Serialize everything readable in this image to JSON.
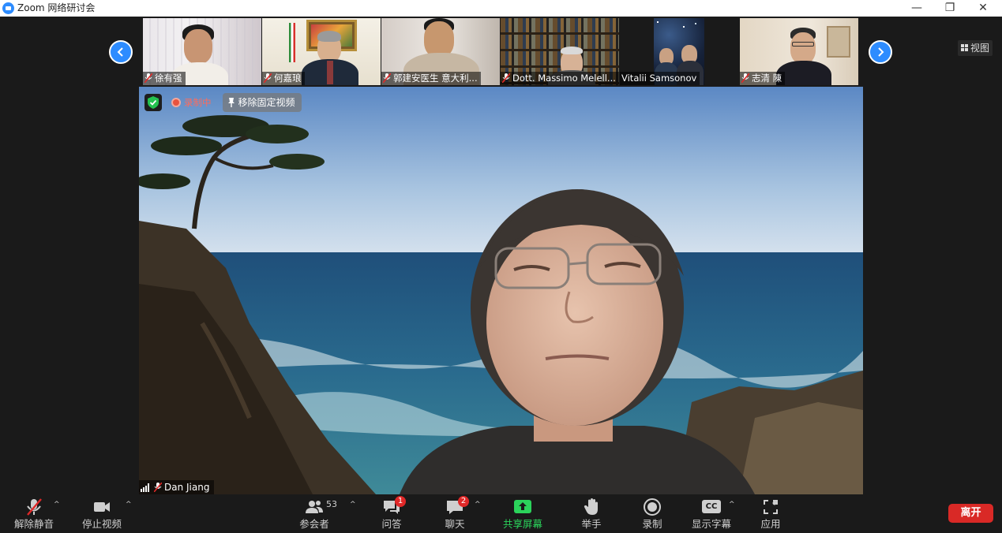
{
  "window": {
    "title": "Zoom 网络研讨会",
    "controls": {
      "minimize": "—",
      "restore": "❐",
      "close": "✕"
    }
  },
  "gallery_strip": {
    "participants": [
      {
        "name": "徐有强",
        "muted": true
      },
      {
        "name": "何嘉琅",
        "muted": true
      },
      {
        "name": "郭建安医生 意大利...",
        "muted": true
      },
      {
        "name": "Dott. Massimo Melell...",
        "muted": true
      },
      {
        "name": "Vitalii Samsonov",
        "muted": false
      },
      {
        "name": "志清 陳",
        "muted": true
      }
    ],
    "prev_icon": "chevron-left-icon",
    "next_icon": "chevron-right-icon"
  },
  "view_button": {
    "label": "视图",
    "icon": "grid-icon"
  },
  "main_video": {
    "speaker_name": "Dan Jiang",
    "recording_label": "录制中",
    "unpin_label": "移除固定视频",
    "muted": true
  },
  "toolbar": {
    "unmute": "解除静音",
    "stop_video": "停止视频",
    "participants": "参会者",
    "participants_count": "53",
    "qa": "问答",
    "qa_badge": "1",
    "chat": "聊天",
    "chat_badge": "2",
    "share_screen": "共享屏幕",
    "raise_hand": "举手",
    "record": "录制",
    "captions": "显示字幕",
    "captions_icon_text": "CC",
    "apps": "应用",
    "leave": "离开"
  },
  "colors": {
    "accent": "#2d8cff",
    "leave": "#d92926",
    "share": "#2bd35b",
    "badge": "#e02828",
    "muted_mic": "#e02828"
  }
}
